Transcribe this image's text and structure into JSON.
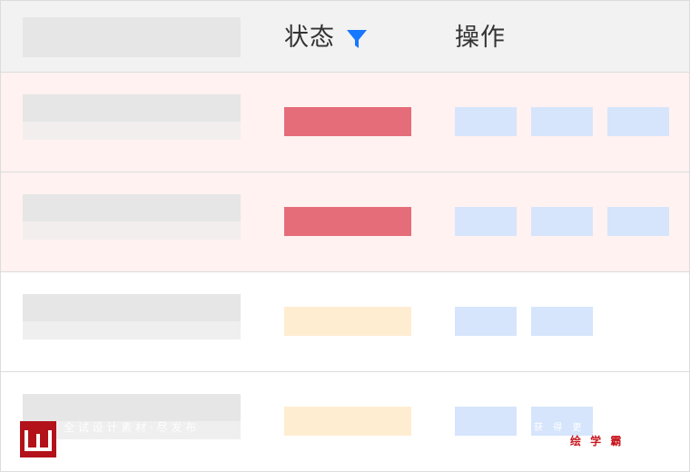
{
  "header": {
    "status_label": "状态",
    "action_label": "操作"
  },
  "icons": {
    "filter": "filter-icon"
  },
  "colors": {
    "header_bg": "#f2f2f2",
    "highlight_row_bg": "#fff2f0",
    "status_red": "#e56c79",
    "status_orange": "#ffedd2",
    "action_blue": "#d6e5fc",
    "filter_icon": "#1677ff"
  },
  "rows": [
    {
      "highlighted": true,
      "status": "red",
      "actions": 3
    },
    {
      "highlighted": true,
      "status": "red",
      "actions": 3
    },
    {
      "highlighted": false,
      "status": "orange",
      "actions": 2
    },
    {
      "highlighted": false,
      "status": "orange",
      "actions": 2
    }
  ],
  "watermark": {
    "left_text": "全 试 设 计 素 材 · 尽 发 布",
    "small_text": "获 得 更 多 免",
    "brand": "绘 学 霸"
  }
}
